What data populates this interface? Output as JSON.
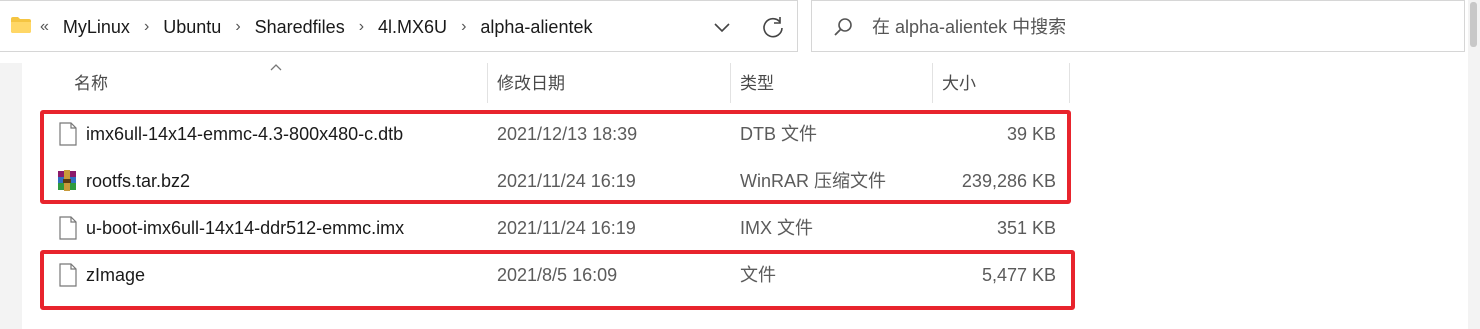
{
  "address_bar": {
    "overflow": "«",
    "crumbs": [
      "MyLinux",
      "Ubuntu",
      "Sharedfiles",
      "4l.MX6U",
      "alpha-alientek"
    ],
    "separator": "›"
  },
  "search": {
    "placeholder": "在 alpha-alientek 中搜索"
  },
  "columns": {
    "name": "名称",
    "date": "修改日期",
    "type": "类型",
    "size": "大小"
  },
  "files": [
    {
      "name": "imx6ull-14x14-emmc-4.3-800x480-c.dtb",
      "date": "2021/12/13 18:39",
      "type": "DTB 文件",
      "size": "39 KB",
      "icon": "file-icon",
      "highlighted": true
    },
    {
      "name": "rootfs.tar.bz2",
      "date": "2021/11/24 16:19",
      "type": "WinRAR 压缩文件",
      "size": "239,286 KB",
      "icon": "winrar-icon",
      "highlighted": true
    },
    {
      "name": "u-boot-imx6ull-14x14-ddr512-emmc.imx",
      "date": "2021/11/24 16:19",
      "type": "IMX 文件",
      "size": "351 KB",
      "icon": "file-icon",
      "highlighted": false
    },
    {
      "name": "zImage",
      "date": "2021/8/5 16:09",
      "type": "文件",
      "size": "5,477 KB",
      "icon": "file-icon",
      "highlighted": true
    }
  ],
  "colors": {
    "highlight": "#e8242d",
    "folder": "#f5c542"
  }
}
